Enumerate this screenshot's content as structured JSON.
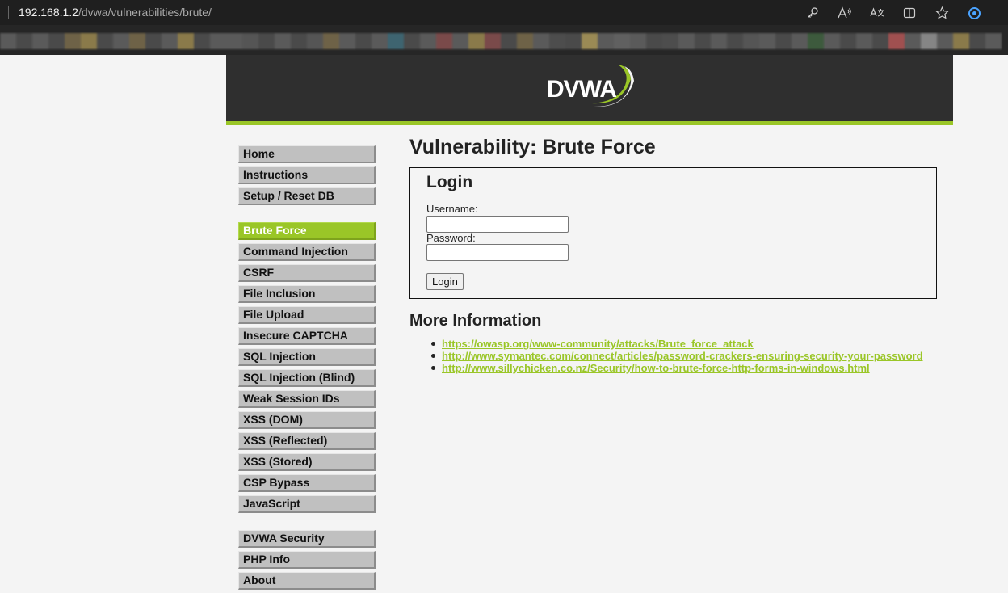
{
  "browser": {
    "url_host": "192.168.1.2",
    "url_path": "/dvwa/vulnerabilities/brute/",
    "toolbar_icons": [
      "key-icon",
      "read-aloud-icon",
      "translate-icon",
      "split-screen-icon",
      "favorite-star-icon",
      "copilot-icon"
    ]
  },
  "header": {
    "logo_text": "DVWA"
  },
  "menu": {
    "group1": [
      "Home",
      "Instructions",
      "Setup / Reset DB"
    ],
    "group2": [
      "Brute Force",
      "Command Injection",
      "CSRF",
      "File Inclusion",
      "File Upload",
      "Insecure CAPTCHA",
      "SQL Injection",
      "SQL Injection (Blind)",
      "Weak Session IDs",
      "XSS (DOM)",
      "XSS (Reflected)",
      "XSS (Stored)",
      "CSP Bypass",
      "JavaScript"
    ],
    "group3": [
      "DVWA Security",
      "PHP Info",
      "About"
    ],
    "selected": "Brute Force"
  },
  "main": {
    "title": "Vulnerability: Brute Force",
    "login": {
      "heading": "Login",
      "username_label": "Username:",
      "username_value": "",
      "password_label": "Password:",
      "password_value": "",
      "button_label": "Login"
    },
    "more_info": {
      "heading": "More Information",
      "links": [
        "https://owasp.org/www-community/attacks/Brute_force_attack",
        "http://www.symantec.com/connect/articles/password-crackers-ensuring-security-your-password",
        "http://www.sillychicken.co.nz/Security/how-to-brute-force-http-forms-in-windows.html"
      ]
    }
  },
  "colors": {
    "accent": "#9ac627",
    "header_bg": "#2f2f2f",
    "menu_bg": "#c0c0c0",
    "page_bg": "#f4f4f4"
  }
}
